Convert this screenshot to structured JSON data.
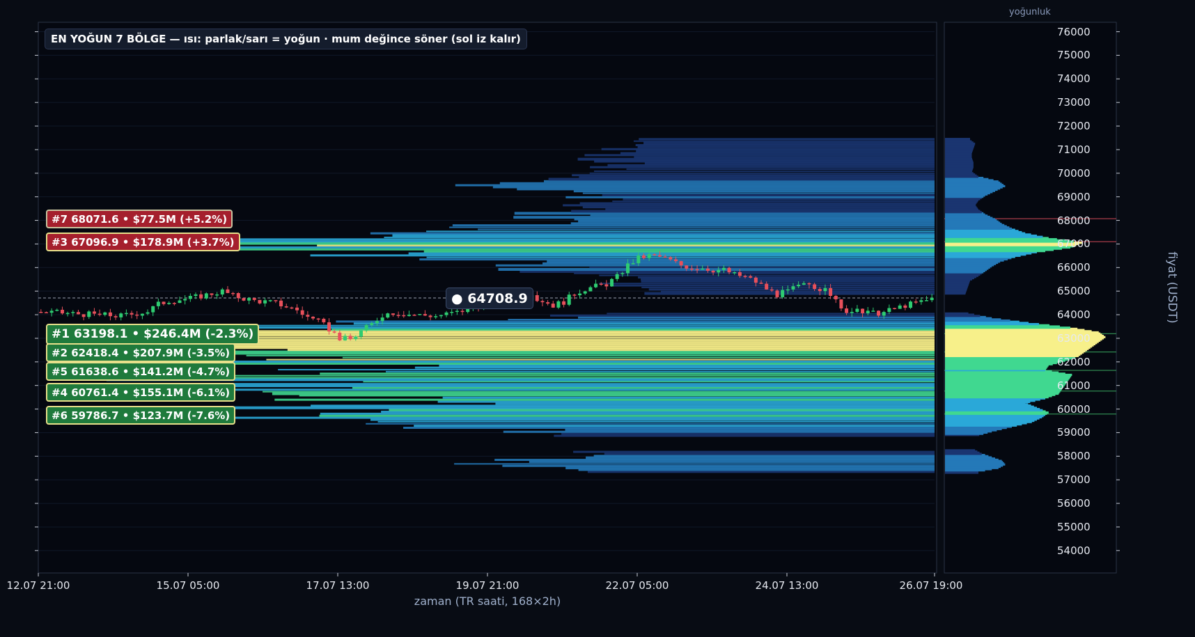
{
  "chart_data": {
    "type": "heatmap",
    "title": "EN YOĞUN 7 BÖLGE — ısı: parlak/sarı = yoğun · mum değince söner (sol iz kalır)",
    "xlabel": "zaman (TR saati, 168×2h)",
    "ylabel": "fiyat (USDT)",
    "side_panel_label": "yoğunluk",
    "x_ticks": [
      "12.07 21:00",
      "15.07 05:00",
      "17.07 13:00",
      "19.07 21:00",
      "22.07 05:00",
      "24.07 13:00",
      "26.07 19:00"
    ],
    "y_ticks": [
      54000,
      55000,
      56000,
      57000,
      58000,
      59000,
      60000,
      61000,
      62000,
      63000,
      64000,
      65000,
      66000,
      67000,
      68000,
      69000,
      70000,
      71000,
      72000,
      73000,
      74000,
      75000,
      76000
    ],
    "ylim": [
      53050,
      76400
    ],
    "bars": 168,
    "current_price": {
      "label": "● 64708.9",
      "value": 64708.9
    },
    "zones": [
      {
        "rank": 7,
        "label": "#7  68071.6  •  $77.5M  (+5.2%)",
        "price": 68071.6,
        "color": "red"
      },
      {
        "rank": 3,
        "label": "#3  67096.9  •  $178.9M  (+3.7%)",
        "price": 67096.9,
        "color": "red"
      },
      {
        "rank": 1,
        "label": "#1  63198.1  •  $246.4M  (-2.3%)",
        "price": 63198.1,
        "color": "green"
      },
      {
        "rank": 2,
        "label": "#2  62418.4  •  $207.9M  (-3.5%)",
        "price": 62418.4,
        "color": "green"
      },
      {
        "rank": 5,
        "label": "#5  61638.6  •  $141.2M  (-4.7%)",
        "price": 61638.6,
        "color": "green"
      },
      {
        "rank": 4,
        "label": "#4  60761.4  •  $155.1M  (-6.1%)",
        "price": 60761.4,
        "color": "green"
      },
      {
        "rank": 6,
        "label": "#6  59786.7  •  $123.7M  (-7.6%)",
        "price": 59786.7,
        "color": "green"
      }
    ],
    "price_path": [
      [
        0,
        64120
      ],
      [
        6,
        64050
      ],
      [
        10,
        64000
      ],
      [
        15,
        63950
      ],
      [
        20,
        64150
      ],
      [
        22,
        64450
      ],
      [
        24,
        64600
      ],
      [
        28,
        64700
      ],
      [
        32,
        64900
      ],
      [
        34,
        65000
      ],
      [
        36,
        64800
      ],
      [
        40,
        64600
      ],
      [
        44,
        64500
      ],
      [
        48,
        64200
      ],
      [
        50,
        63900
      ],
      [
        52,
        63700
      ],
      [
        54,
        63400
      ],
      [
        56,
        63000
      ],
      [
        58,
        62950
      ],
      [
        60,
        63300
      ],
      [
        62,
        63600
      ],
      [
        64,
        64000
      ],
      [
        66,
        64100
      ],
      [
        70,
        64000
      ],
      [
        74,
        63950
      ],
      [
        78,
        64100
      ],
      [
        80,
        64250
      ],
      [
        82,
        64400
      ],
      [
        84,
        64550
      ],
      [
        86,
        64700
      ],
      [
        88,
        64800
      ],
      [
        90,
        64750
      ],
      [
        92,
        64700
      ],
      [
        94,
        64600
      ],
      [
        96,
        64400
      ],
      [
        98,
        64550
      ],
      [
        100,
        64900
      ],
      [
        102,
        65100
      ],
      [
        104,
        65200
      ],
      [
        106,
        65300
      ],
      [
        108,
        65600
      ],
      [
        110,
        66100
      ],
      [
        112,
        66400
      ],
      [
        114,
        66500
      ],
      [
        116,
        66450
      ],
      [
        118,
        66300
      ],
      [
        120,
        66100
      ],
      [
        122,
        66000
      ],
      [
        124,
        66000
      ],
      [
        126,
        65900
      ],
      [
        128,
        65900
      ],
      [
        130,
        65700
      ],
      [
        132,
        65600
      ],
      [
        134,
        65400
      ],
      [
        136,
        65100
      ],
      [
        138,
        64850
      ],
      [
        140,
        65000
      ],
      [
        142,
        65200
      ],
      [
        144,
        65300
      ],
      [
        146,
        65100
      ],
      [
        148,
        64900
      ],
      [
        150,
        64200
      ],
      [
        152,
        64150
      ],
      [
        154,
        64100
      ],
      [
        156,
        64050
      ],
      [
        158,
        64100
      ],
      [
        160,
        64250
      ],
      [
        162,
        64400
      ],
      [
        164,
        64500
      ],
      [
        166,
        64600
      ],
      [
        167,
        64700
      ]
    ],
    "profile": [
      [
        57350,
        0.2
      ],
      [
        57500,
        0.32
      ],
      [
        57650,
        0.36
      ],
      [
        57800,
        0.34
      ],
      [
        57950,
        0.28
      ],
      [
        58100,
        0.22
      ],
      [
        58250,
        0.18
      ],
      [
        58850,
        0.18
      ],
      [
        59050,
        0.28
      ],
      [
        59250,
        0.4
      ],
      [
        59450,
        0.52
      ],
      [
        59650,
        0.58
      ],
      [
        59850,
        0.62
      ],
      [
        60050,
        0.55
      ],
      [
        60250,
        0.48
      ],
      [
        60450,
        0.6
      ],
      [
        60650,
        0.68
      ],
      [
        60850,
        0.7
      ],
      [
        61050,
        0.72
      ],
      [
        61250,
        0.74
      ],
      [
        61450,
        0.76
      ],
      [
        61650,
        0.6
      ],
      [
        61850,
        0.62
      ],
      [
        62050,
        0.72
      ],
      [
        62250,
        0.8
      ],
      [
        62450,
        0.84
      ],
      [
        62650,
        0.88
      ],
      [
        62850,
        0.92
      ],
      [
        63050,
        0.96
      ],
      [
        63250,
        0.92
      ],
      [
        63450,
        0.75
      ],
      [
        63650,
        0.5
      ],
      [
        63850,
        0.28
      ],
      [
        64050,
        0.14
      ],
      [
        64850,
        0.12
      ],
      [
        65050,
        0.13
      ],
      [
        65250,
        0.14
      ],
      [
        65450,
        0.15
      ],
      [
        65650,
        0.2
      ],
      [
        65850,
        0.24
      ],
      [
        66050,
        0.28
      ],
      [
        66250,
        0.33
      ],
      [
        66450,
        0.42
      ],
      [
        66650,
        0.55
      ],
      [
        66850,
        0.75
      ],
      [
        67050,
        0.82
      ],
      [
        67250,
        0.62
      ],
      [
        67450,
        0.48
      ],
      [
        67650,
        0.4
      ],
      [
        67850,
        0.34
      ],
      [
        68050,
        0.3
      ],
      [
        68250,
        0.24
      ],
      [
        68450,
        0.2
      ],
      [
        68650,
        0.18
      ],
      [
        68850,
        0.2
      ],
      [
        69050,
        0.24
      ],
      [
        69250,
        0.3
      ],
      [
        69450,
        0.36
      ],
      [
        69650,
        0.32
      ],
      [
        69850,
        0.2
      ],
      [
        70050,
        0.16
      ],
      [
        70250,
        0.17
      ],
      [
        70450,
        0.17
      ],
      [
        70650,
        0.16
      ],
      [
        70850,
        0.16
      ],
      [
        71050,
        0.17
      ],
      [
        71250,
        0.18
      ],
      [
        71400,
        0.15
      ]
    ]
  },
  "colors": {
    "background": "#080c14",
    "panel_border": "#2a3346",
    "candle_up": "#2ecc71",
    "candle_down": "#e8505b",
    "heat_low": "#1a3570",
    "heat_mid": "#2aa8d8",
    "heat_high": "#40d890",
    "heat_max": "#f7f08a",
    "zone_red_line": "#d04a58",
    "zone_green_line": "#3aa860",
    "price_line": "#c0c8d8"
  }
}
